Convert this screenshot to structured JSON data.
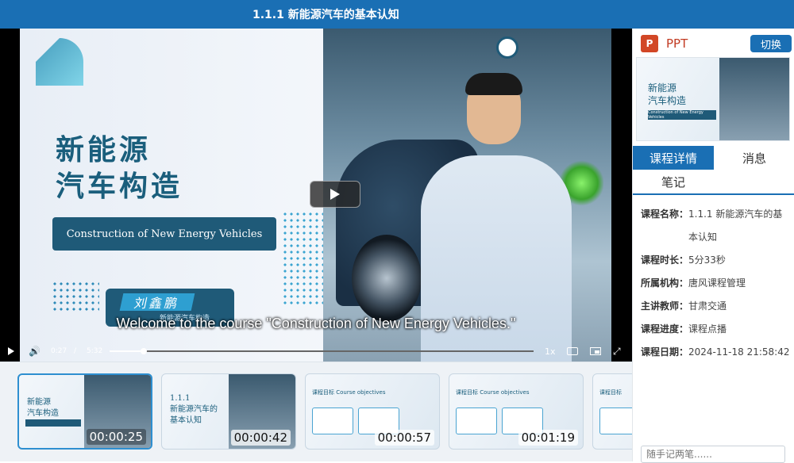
{
  "header": {
    "title": "1.1.1 新能源汽车的基本认知"
  },
  "slide": {
    "title_line1": "新能源",
    "title_line2": "汽车构造",
    "subtitle_en": "Construction of New Energy Vehicles",
    "presenter": "刘鑫鹏",
    "presenter_sub": "新能源汽车构造"
  },
  "player": {
    "subtitle": "Welcome to the course \"Construction of New Energy Vehicles.\"",
    "current_time": "0:27",
    "separator": "/",
    "total_time": "5:32",
    "progress_fraction": 0.081,
    "speed": "1x"
  },
  "thumbnails": [
    {
      "title": "新能源\n汽车构造",
      "time": "00:00:25",
      "active": true
    },
    {
      "title": "1.1.1\n新能源汽车的\n基本认知",
      "time": "00:00:42",
      "active": false
    },
    {
      "heading": "课程目标 Course objectives",
      "time": "00:00:57",
      "active": false
    },
    {
      "heading": "课程目标 Course objectives",
      "time": "00:01:19",
      "active": false
    },
    {
      "heading": "课程目标",
      "time": "",
      "active": false
    }
  ],
  "sidebar": {
    "ppt_label": "PPT",
    "ppt_icon": "P",
    "switch_label": "切换",
    "ppt_preview_title": "新能源\n汽车构造",
    "ppt_preview_sub": "Construction of New Energy Vehicles",
    "tabs": [
      {
        "label": "课程详情",
        "active": true
      },
      {
        "label": "消息",
        "active": false
      },
      {
        "label": "笔记",
        "active": false
      }
    ],
    "details": [
      {
        "key": "课程名称：",
        "value": "1.1.1 新能源汽车的基本认知"
      },
      {
        "key": "课程时长：",
        "value": "5分33秒"
      },
      {
        "key": "所属机构：",
        "value": "唐风课程管理"
      },
      {
        "key": "主讲教师：",
        "value": "甘肃交通"
      },
      {
        "key": "课程进度：",
        "value": "课程点播"
      },
      {
        "key": "课程日期：",
        "value": "2024-11-18 21:58:42"
      }
    ],
    "note_placeholder": "随手记两笔......"
  },
  "colors": {
    "primary": "#1a6fb4",
    "ppt_red": "#d24726",
    "slide_navy": "#1f5a78"
  }
}
